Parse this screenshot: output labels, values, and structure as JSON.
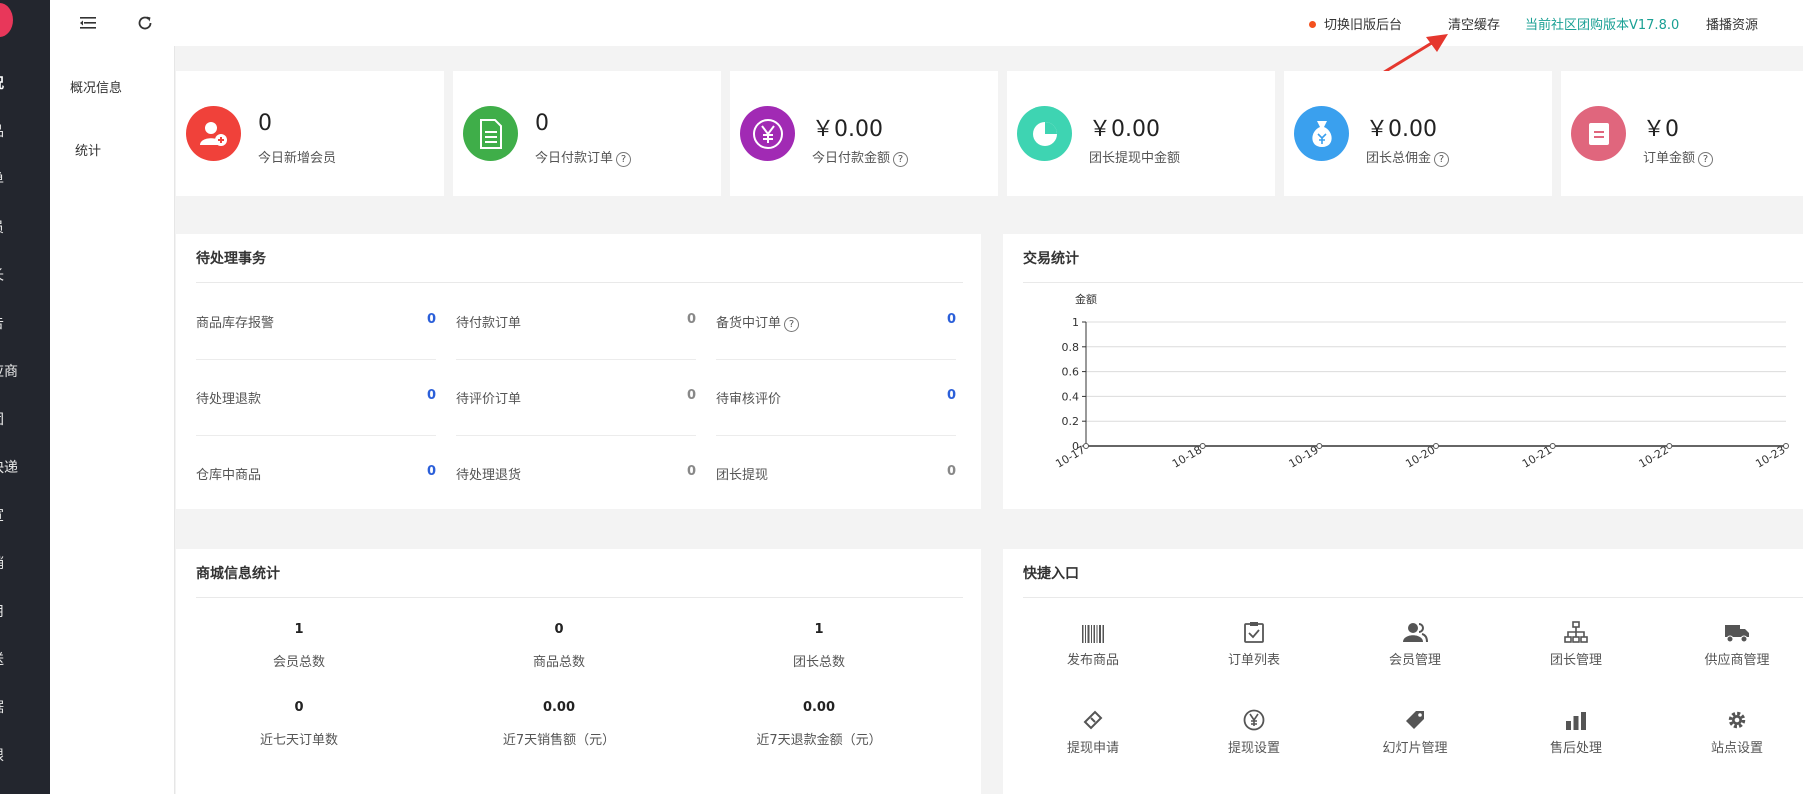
{
  "colors": {
    "blue_value": "#2b5fd9",
    "gray_value": "#888888",
    "teal_link": "#1aa094",
    "sidebar_bg": "#23262e"
  },
  "sidebar": {
    "items": [
      {
        "label": "况",
        "icon": "dashboard"
      },
      {
        "label": "品",
        "icon": "goods"
      },
      {
        "label": "单",
        "icon": "order"
      },
      {
        "label": "员",
        "icon": "member"
      },
      {
        "label": "长",
        "icon": "leader"
      },
      {
        "label": "告",
        "icon": "notice"
      },
      {
        "label": "应商",
        "icon": "supplier"
      },
      {
        "label": "团",
        "icon": "group"
      },
      {
        "label": "快递",
        "icon": "express"
      },
      {
        "label": "宣",
        "icon": "promo"
      },
      {
        "label": "销",
        "icon": "sales"
      },
      {
        "label": "用",
        "icon": "apps"
      },
      {
        "label": "送",
        "icon": "delivery"
      },
      {
        "label": "据",
        "icon": "data"
      },
      {
        "label": "限",
        "icon": "permission"
      }
    ]
  },
  "subnav": {
    "items": [
      "概况信息",
      "统计"
    ]
  },
  "topbar": {
    "switch_old": "切换旧版后台",
    "clear_cache": "清空缓存",
    "version": "当前社区团购版本V17.8.0",
    "broadcast": "播播资源"
  },
  "stats": [
    {
      "value": "0",
      "label": "今日新增会员",
      "help": false,
      "color": "#f0413a",
      "icon": "user-add"
    },
    {
      "value": "0",
      "label": "今日付款订单",
      "help": true,
      "color": "#3fae49",
      "icon": "document"
    },
    {
      "value": "￥0.00",
      "label": "今日付款金额",
      "help": true,
      "color": "#a12ab4",
      "icon": "yen"
    },
    {
      "value": "￥0.00",
      "label": "团长提现中金额",
      "help": false,
      "color": "#3ed4b2",
      "icon": "pie"
    },
    {
      "value": "￥0.00",
      "label": "团长总佣金",
      "help": true,
      "color": "#3aa0ee",
      "icon": "money-bag"
    },
    {
      "value": "￥0",
      "label": "订单金额",
      "help": true,
      "color": "#e0667d",
      "icon": "note"
    }
  ],
  "todo": {
    "title": "待处理事务",
    "items": [
      {
        "label": "商品库存报警",
        "value": "0",
        "highlight": true,
        "help": false
      },
      {
        "label": "待付款订单",
        "value": "0",
        "highlight": false,
        "help": false
      },
      {
        "label": "备货中订单",
        "value": "0",
        "highlight": true,
        "help": true
      },
      {
        "label": "待处理退款",
        "value": "0",
        "highlight": true,
        "help": false
      },
      {
        "label": "待评价订单",
        "value": "0",
        "highlight": false,
        "help": false
      },
      {
        "label": "待审核评价",
        "value": "0",
        "highlight": true,
        "help": false
      },
      {
        "label": "仓库中商品",
        "value": "0",
        "highlight": true,
        "help": false
      },
      {
        "label": "待处理退货",
        "value": "0",
        "highlight": false,
        "help": false
      },
      {
        "label": "团长提现",
        "value": "0",
        "highlight": false,
        "help": false
      }
    ]
  },
  "trade": {
    "title": "交易统计"
  },
  "chart_data": {
    "type": "line",
    "title": "",
    "ylabel": "金额",
    "categories": [
      "10-17",
      "10-18",
      "10-19",
      "10-20",
      "10-21",
      "10-22",
      "10-23"
    ],
    "series": [
      {
        "values": [
          0,
          0,
          0,
          0,
          0,
          0,
          0
        ]
      }
    ],
    "yticks": [
      "0",
      "0.2",
      "0.4",
      "0.6",
      "0.8",
      "1"
    ],
    "ylim": [
      0,
      1
    ],
    "grid": true
  },
  "mall": {
    "title": "商城信息统计",
    "items": [
      {
        "value": "1",
        "label": "会员总数"
      },
      {
        "value": "0",
        "label": "商品总数"
      },
      {
        "value": "1",
        "label": "团长总数"
      },
      {
        "value": "0",
        "label": "近七天订单数"
      },
      {
        "value": "0.00",
        "label": "近7天销售额（元）"
      },
      {
        "value": "0.00",
        "label": "近7天退款金额（元）"
      }
    ]
  },
  "quick": {
    "title": "快捷入口",
    "items": [
      {
        "label": "发布商品",
        "icon": "barcode"
      },
      {
        "label": "订单列表",
        "icon": "clipboard-check"
      },
      {
        "label": "会员管理",
        "icon": "users"
      },
      {
        "label": "团长管理",
        "icon": "org-chart"
      },
      {
        "label": "供应商管理",
        "icon": "truck"
      },
      {
        "label": "提现申请",
        "icon": "ticket"
      },
      {
        "label": "提现设置",
        "icon": "yen-circle"
      },
      {
        "label": "幻灯片管理",
        "icon": "tag"
      },
      {
        "label": "售后处理",
        "icon": "bars"
      },
      {
        "label": "站点设置",
        "icon": "gear"
      }
    ]
  }
}
